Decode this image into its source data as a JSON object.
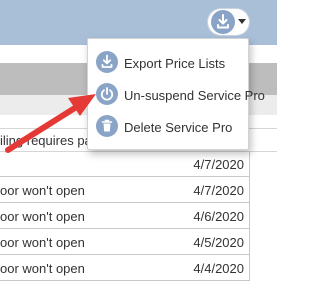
{
  "menu": {
    "items": [
      {
        "label": "Export Price Lists",
        "icon": "download-icon"
      },
      {
        "label": "Un-suspend Service Pro",
        "icon": "power-icon"
      },
      {
        "label": "Delete Service Pro",
        "icon": "trash-icon"
      }
    ]
  },
  "description_row": {
    "text": "iling requires pain"
  },
  "table": {
    "rows": [
      {
        "text": "",
        "date": "4/7/2020"
      },
      {
        "text": "oor won't open",
        "date": "4/7/2020"
      },
      {
        "text": "oor won't open",
        "date": "4/6/2020"
      },
      {
        "text": "oor won't open",
        "date": "4/5/2020"
      },
      {
        "text": "oor won't open",
        "date": "4/4/2020"
      }
    ]
  },
  "colors": {
    "header": "#a9bfd8",
    "icon_blue": "#8aa4c8",
    "annotation_arrow": "#e53935"
  }
}
